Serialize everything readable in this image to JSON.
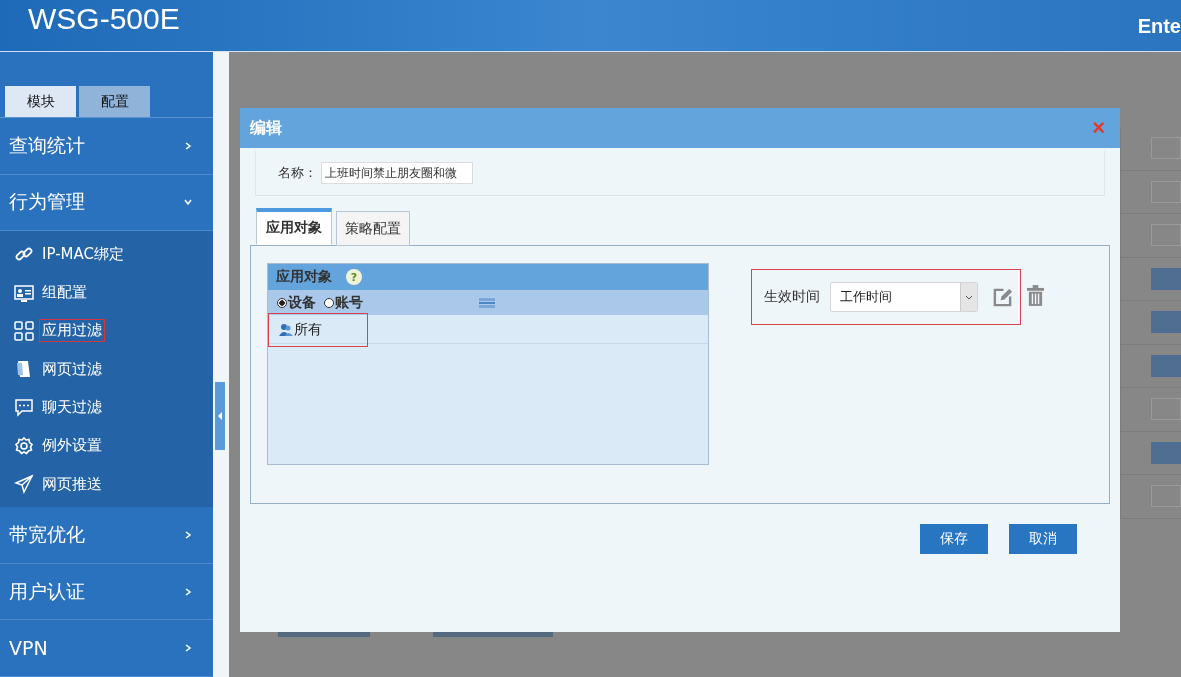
{
  "header": {
    "logo": "WSG-500E",
    "right_text": "Ente"
  },
  "sidebar": {
    "tabs": [
      {
        "label": "模块",
        "selected": false
      },
      {
        "label": "配置",
        "selected": true
      }
    ],
    "sections": [
      {
        "label": "查询统计",
        "expanded": false
      },
      {
        "label": "行为管理",
        "expanded": true,
        "children": [
          {
            "label": "IP-MAC绑定",
            "selected": false
          },
          {
            "label": "组配置",
            "selected": false
          },
          {
            "label": "应用过滤",
            "selected": true
          },
          {
            "label": "网页过滤",
            "selected": false
          },
          {
            "label": "聊天过滤",
            "selected": false
          },
          {
            "label": "例外设置",
            "selected": false
          },
          {
            "label": "网页推送",
            "selected": false
          }
        ]
      },
      {
        "label": "带宽优化",
        "expanded": false
      },
      {
        "label": "用户认证",
        "expanded": false
      },
      {
        "label": "VPN",
        "expanded": false
      }
    ]
  },
  "background_rows": [
    {
      "on": false
    },
    {
      "on": false
    },
    {
      "on": false
    },
    {
      "on": true
    },
    {
      "on": true
    },
    {
      "on": true
    },
    {
      "on": false
    },
    {
      "on": true
    },
    {
      "on": false
    }
  ],
  "dialog": {
    "title": "编辑",
    "close": "×",
    "name_label": "名称：",
    "name_value": "上班时间禁止朋友圈和微",
    "tabs": [
      {
        "label": "应用对象",
        "selected": true
      },
      {
        "label": "策略配置",
        "selected": false
      }
    ],
    "objects": {
      "title": "应用对象",
      "help": "?",
      "radios": [
        {
          "label": "设备",
          "selected": true
        },
        {
          "label": "账号",
          "selected": false
        }
      ],
      "items": [
        {
          "label": "所有",
          "highlighted": true
        }
      ]
    },
    "time_label": "生效时间",
    "time_value": "工作时间",
    "buttons": [
      "保存",
      "取消"
    ]
  }
}
